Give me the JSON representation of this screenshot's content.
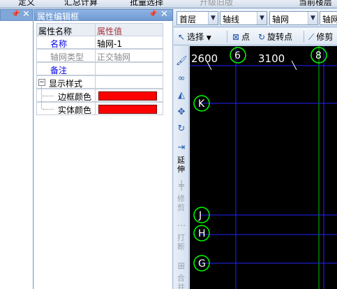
{
  "top_toolbar": {
    "items": [
      "定义",
      "汇总计算",
      "批量选择",
      "升级旧版"
    ],
    "right_item": "当前楼层"
  },
  "property_panel": {
    "title": "属性编辑框",
    "header": {
      "name": "属性名称",
      "value": "属性值"
    },
    "rows": [
      {
        "name": "名称",
        "value": "轴网-1"
      },
      {
        "name": "轴网类型",
        "value": "正交轴网"
      },
      {
        "name": "备注",
        "value": ""
      }
    ],
    "group": {
      "label": "显示样式",
      "expander": "−",
      "children": [
        {
          "name": "边框颜色",
          "color": "#ff0000"
        },
        {
          "name": "实体颜色",
          "color": "#ff0000"
        }
      ]
    }
  },
  "combos": [
    {
      "value": "首层"
    },
    {
      "value": "轴线"
    },
    {
      "value": "轴网"
    },
    {
      "value": "轴网"
    }
  ],
  "toolbar2": {
    "select": "选择",
    "point": "点",
    "rotate_point": "旋转点",
    "trim": "修剪"
  },
  "side_tools": {
    "extend": "延伸",
    "trim": "修剪",
    "break": "打断",
    "merge": "合并"
  },
  "canvas": {
    "dimensions": [
      "2600",
      "3100"
    ],
    "column_bubbles": [
      "6",
      "8"
    ],
    "row_bubbles": [
      "K",
      "J",
      "H",
      "G"
    ],
    "colors": {
      "background": "#000000",
      "axis": "#2222ff",
      "bubble": "#00ff00",
      "dim_line": "#00c000"
    }
  }
}
